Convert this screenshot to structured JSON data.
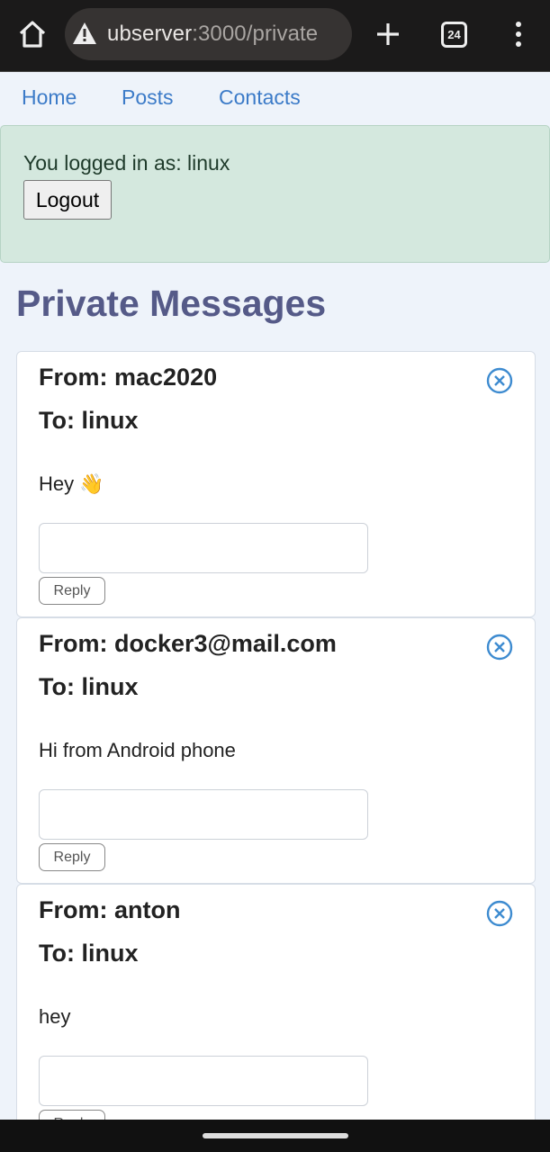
{
  "browser": {
    "url_host": "ubserver",
    "url_rest": ":3000/private",
    "tab_count": "24",
    "icons": [
      "home-icon",
      "warning-icon",
      "plus-icon",
      "tabs-icon",
      "more-vert-icon"
    ]
  },
  "nav": {
    "items": [
      "Home",
      "Posts",
      "Contacts"
    ]
  },
  "session": {
    "message": "You logged in as: linux",
    "logout_label": "Logout"
  },
  "page": {
    "title": "Private Messages"
  },
  "messages": [
    {
      "from": "From: mac2020",
      "to": "To: linux",
      "body": "Hey 👋",
      "reply_placeholder": "",
      "reply_label": "Reply"
    },
    {
      "from": "From: docker3@mail.com",
      "to": "To: linux",
      "body": "Hi from Android phone",
      "reply_placeholder": "",
      "reply_label": "Reply"
    },
    {
      "from": "From: anton",
      "to": "To: linux",
      "body": "hey",
      "reply_placeholder": "",
      "reply_label": "Reply"
    }
  ],
  "colors": {
    "link": "#3c7bc8",
    "title": "#555a88",
    "alert_bg": "#d4e8de",
    "close_icon": "#3d8bd0"
  }
}
